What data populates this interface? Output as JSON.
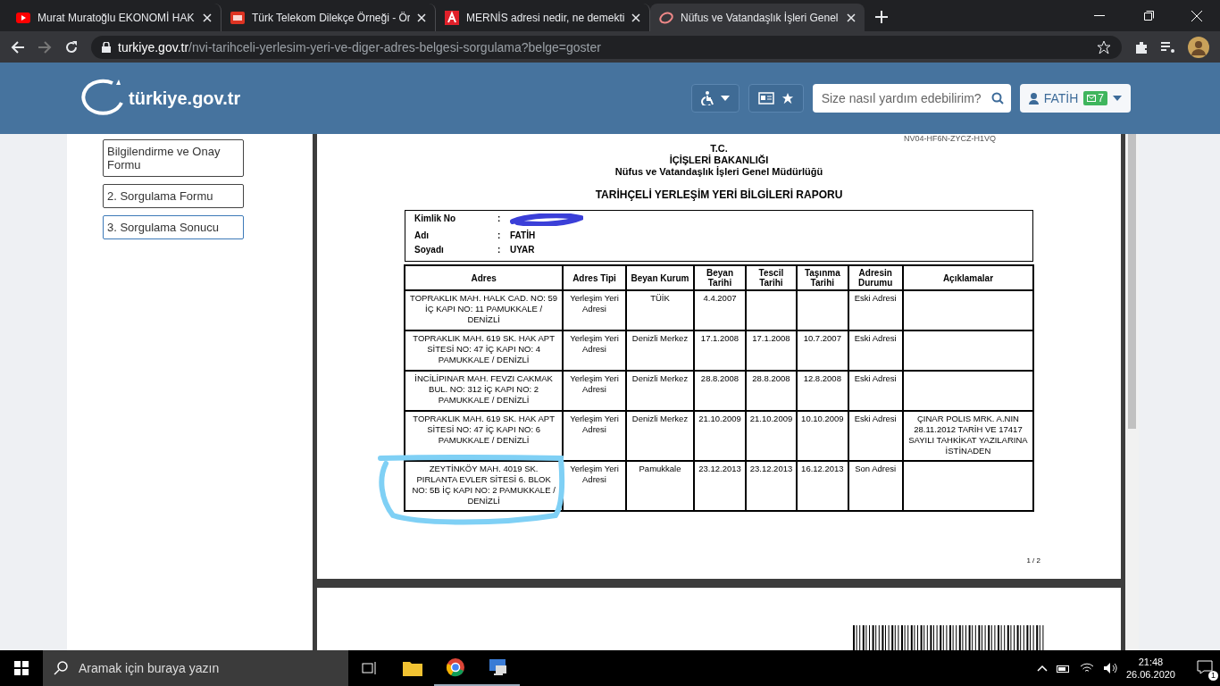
{
  "browser": {
    "tabs": [
      {
        "title": "Murat Muratoğlu EKONOMİ HAK",
        "kind": "youtube",
        "selected": false
      },
      {
        "title": "Türk Telekom Dilekçe Örneği - Ör",
        "kind": "dh",
        "selected": false
      },
      {
        "title": "MERNİS adresi nedir, ne demekti",
        "kind": "letter-a",
        "selected": false
      },
      {
        "title": "Nüfus ve Vatandaşlık İşleri Genel",
        "kind": "swirl",
        "selected": true
      }
    ],
    "url_host": "turkiye.gov.tr",
    "url_path": "/nvi-tarihceli-yerlesim-yeri-ve-diger-adres-belgesi-sorgulama?belge=goster"
  },
  "header": {
    "logo": "türkiye.gov.tr",
    "search": {
      "placeholder": "Size nasıl yardım edebilirim?"
    },
    "user": {
      "name": "FATİH",
      "messages": "7"
    }
  },
  "sidebar": {
    "items": [
      {
        "label": "Bilgilendirme ve Onay Formu",
        "selected": false
      },
      {
        "label": "2. Sorgulama Formu",
        "selected": false
      },
      {
        "label": "3. Sorgulama Sonucu",
        "selected": true
      }
    ]
  },
  "document": {
    "code": "NV04-HF6N-ZYCZ-H1VQ",
    "header_lines": [
      "T.C.",
      "İÇİŞLERİ BAKANLIĞI",
      "Nüfus ve Vatandaşlık İşleri Genel Müdürlüğü"
    ],
    "title": "TARİHÇELİ YERLEŞİM YERİ BİLGİLERİ RAPORU",
    "identity": [
      {
        "label": "Kimlik No",
        "colon": ":",
        "redacted": true
      },
      {
        "label": "Adı",
        "colon": ":",
        "value": "FATİH",
        "redacted": false
      },
      {
        "label": "Soyadı",
        "colon": ":",
        "value": "UYAR",
        "redacted": false
      }
    ],
    "table": {
      "columns": [
        "Adres",
        "Adres Tipi",
        "Beyan Kurum",
        "Beyan Tarihi",
        "Tescil Tarihi",
        "Taşınma Tarihi",
        "Adresin Durumu",
        "Açıklamalar"
      ],
      "rows": [
        [
          "TOPRAKLIK MAH. HALK CAD.  NO: 59  İÇ KAPI NO: 11 PAMUKKALE / DENİZLİ",
          "Yerleşim Yeri Adresi",
          "TÜİK",
          "4.4.2007",
          "",
          "",
          "Eski Adresi",
          ""
        ],
        [
          "TOPRAKLIK MAH. 619 SK. HAK APT SİTESİ  NO: 47  İÇ KAPI NO: 4 PAMUKKALE / DENİZLİ",
          "Yerleşim Yeri Adresi",
          "Denizli Merkez",
          "17.1.2008",
          "17.1.2008",
          "10.7.2007",
          "Eski Adresi",
          ""
        ],
        [
          "İNCİLİPINAR MAH. FEVZI CAKMAK BUL.  NO: 312  İÇ KAPI NO: 2 PAMUKKALE / DENİZLİ",
          "Yerleşim Yeri Adresi",
          "Denizli Merkez",
          "28.8.2008",
          "28.8.2008",
          "12.8.2008",
          "Eski Adresi",
          ""
        ],
        [
          "TOPRAKLIK MAH. 619 SK. HAK APT SİTESİ  NO: 47  İÇ KAPI NO: 6 PAMUKKALE / DENİZLİ",
          "Yerleşim Yeri Adresi",
          "Denizli Merkez",
          "21.10.2009",
          "21.10.2009",
          "10.10.2009",
          "Eski Adresi",
          "ÇINAR POLIS MRK. A.NIN 28.11.2012 TARİH VE 17417 SAYILI TAHKİKAT YAZILARINA İSTİNADEN"
        ],
        [
          "ZEYTİNKÖY MAH. 4019 SK. PIRLANTA  EVLER SİTESİ 6. BLOK NO: 5B  İÇ KAPI NO: 2 PAMUKKALE / DENİZLİ",
          "Yerleşim Yeri Adresi",
          "Pamukkale",
          "23.12.2013",
          "23.12.2013",
          "16.12.2013",
          "Son Adresi",
          ""
        ]
      ]
    },
    "page_number": "1 / 2"
  },
  "taskbar": {
    "search_placeholder": "Aramak için buraya yazın",
    "time": "21:48",
    "date": "26.06.2020",
    "notifications": "1"
  }
}
